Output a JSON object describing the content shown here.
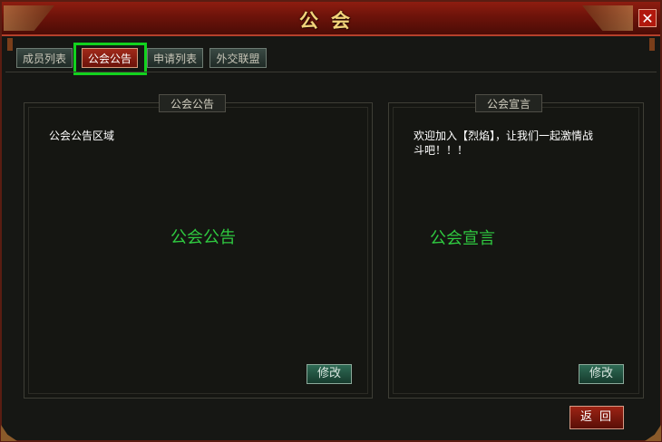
{
  "window": {
    "title": "公会"
  },
  "tabs": [
    {
      "label": "成员列表"
    },
    {
      "label": "公会公告"
    },
    {
      "label": "申请列表"
    },
    {
      "label": "外交联盟"
    }
  ],
  "notice_panel": {
    "title": "公会公告",
    "content": "公会公告区域",
    "watermark": "公会公告",
    "edit_label": "修改"
  },
  "declaration_panel": {
    "title": "公会宣言",
    "content_line1": "欢迎加入【烈焰】，让我们一起激情战",
    "content_line2": "斗吧！！！",
    "watermark": "公会宣言",
    "edit_label": "修改"
  },
  "back_label": "返回",
  "colors": {
    "accent": "#12d21e",
    "title": "#f2d37a",
    "watermark": "#2fca40"
  }
}
